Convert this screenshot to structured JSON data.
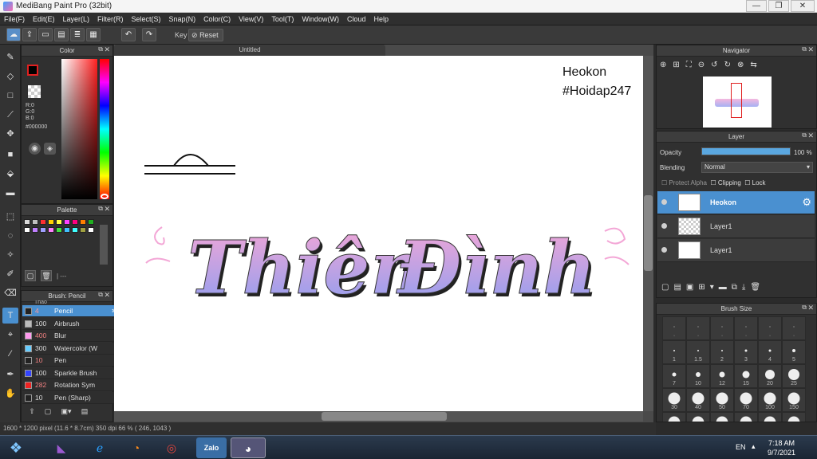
{
  "window": {
    "title": "MediBang Paint Pro (32bit)",
    "minimize": "—",
    "restore": "❐",
    "close": "✕"
  },
  "menu": [
    "File(F)",
    "Edit(E)",
    "Layer(L)",
    "Filter(R)",
    "Select(S)",
    "Snap(N)",
    "Color(C)",
    "View(V)",
    "Tool(T)",
    "Window(W)",
    "Cloud",
    "Help"
  ],
  "toolbar": {
    "key_label": "Key",
    "reset_label": "Reset"
  },
  "color_panel": {
    "title": "Color",
    "r": "R:0",
    "g": "G:0",
    "b": "B:0",
    "hex": "#000000"
  },
  "palette_panel": {
    "title": "Palette",
    "footer": "| ---",
    "swatches": [
      "#d9d9d9",
      "#c0c0c0",
      "#ff3030",
      "#ffd000",
      "#ffff40",
      "#ff40ff",
      "#ff0080",
      "#ff8000",
      "#20b020",
      "#ffffff",
      "#c080ff",
      "#a0a0ff",
      "#ff80ff",
      "#40e040",
      "#40c0ff",
      "#40ffff",
      "#a0a040",
      "#ffffff"
    ]
  },
  "brush_panel": {
    "title": "Brush: Pencil",
    "top_partial": "Thảo",
    "items": [
      {
        "size": "4",
        "name": "Pencil",
        "color": "#222222",
        "selected": true
      },
      {
        "size": "100",
        "name": "Airbrush",
        "color": "#bbbbbb"
      },
      {
        "size": "400",
        "name": "Blur",
        "color": "#ff99ee"
      },
      {
        "size": "300",
        "name": "Watercolor (W",
        "color": "#66ccff"
      },
      {
        "size": "10",
        "name": "Pen",
        "color": "#222222"
      },
      {
        "size": "100",
        "name": "Sparkle Brush",
        "color": "#3344ff"
      },
      {
        "size": "282",
        "name": "Rotation Sym",
        "color": "#ee2222"
      },
      {
        "size": "10",
        "name": "Pen (Sharp)",
        "color": "#222222"
      }
    ]
  },
  "document": {
    "tab": "Untitled",
    "note_line1": "Heokon",
    "note_line2": "#Hoidap247",
    "word1": "Thiên",
    "word2": "Đình"
  },
  "navigator": {
    "title": "Navigator"
  },
  "layer_panel": {
    "title": "Layer",
    "opacity_label": "Opacity",
    "opacity_value": "100 %",
    "opacity_fraction": 1.0,
    "blending_label": "Blending",
    "blending_value": "Normal",
    "protect_alpha": "Protect Alpha",
    "clipping": "Clipping",
    "lock": "Lock",
    "layers": [
      {
        "name": "Heokon",
        "selected": true
      },
      {
        "name": "Layer1"
      },
      {
        "name": "Layer1"
      }
    ]
  },
  "brush_size_panel": {
    "title": "Brush Size",
    "sizes": [
      "·",
      "·",
      "·",
      "·",
      "·",
      "·",
      "1",
      "1.5",
      "2",
      "3",
      "4",
      "5",
      "7",
      "10",
      "12",
      "15",
      "20",
      "25",
      "30",
      "40",
      "50",
      "70",
      "100",
      "150",
      "",
      "",
      "",
      "",
      "",
      ""
    ]
  },
  "status": {
    "text": "1600 * 1200 pixel   (11.6 * 8.7cm)   350 dpi   66 %   ( 246, 1043 )"
  },
  "taskbar": {
    "lang": "EN",
    "time": "7:18 AM",
    "date": "9/7/2021",
    "zalo": "Zalo"
  }
}
